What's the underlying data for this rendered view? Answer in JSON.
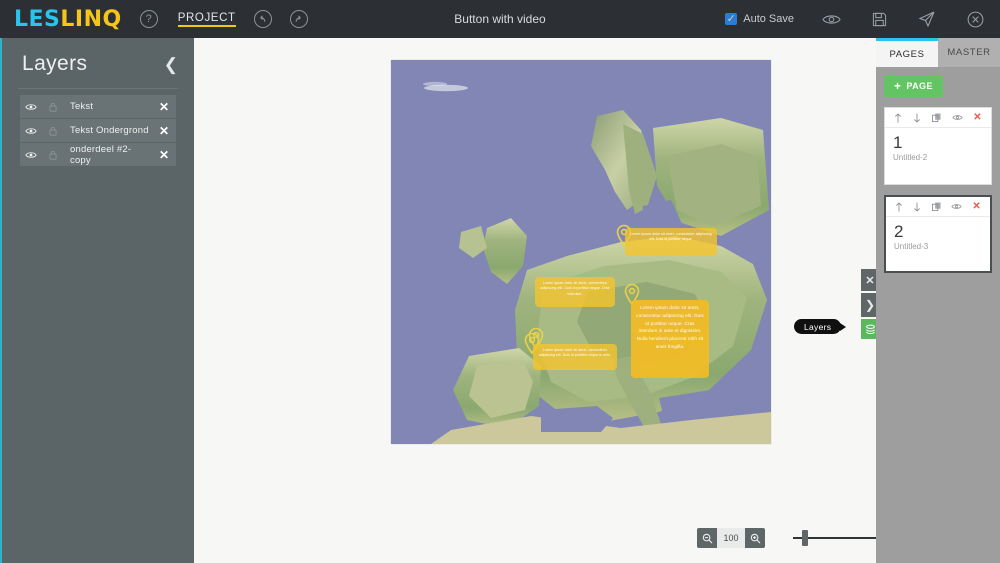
{
  "header": {
    "logo_les": "LES",
    "logo_linq": "LINQ",
    "help_icon": "question-circle-icon",
    "project_label": "PROJECT",
    "undo_icon": "undo-circle-icon",
    "redo_icon": "redo-circle-icon",
    "title": "Button with video",
    "autosave_label": "Auto Save",
    "autosave_checked": true,
    "preview_icon": "eye-icon",
    "save_icon": "floppy-disk-icon",
    "publish_icon": "paper-plane-icon",
    "close_icon": "close-circle-icon"
  },
  "layers": {
    "title": "Layers",
    "collapse_icon": "chevron-left-icon",
    "items": [
      {
        "name": "Tekst",
        "visible_icon": "eye-icon",
        "lock_icon": "lock-icon",
        "delete_icon": "close-icon"
      },
      {
        "name": "Tekst Ondergrond",
        "visible_icon": "eye-icon",
        "lock_icon": "lock-icon",
        "delete_icon": "close-icon"
      },
      {
        "name": "onderdeel #2-copy",
        "visible_icon": "eye-icon",
        "lock_icon": "lock-icon",
        "delete_icon": "close-icon"
      }
    ]
  },
  "canvas": {
    "markers": [
      {
        "id": "marker-north",
        "text": "Lorem ipsum dolor sit amet, consectetur adipiscing elit. Duis id porttitor neque."
      },
      {
        "id": "marker-west",
        "text": "Lorem ipsum dolor sit amet, consectetur adipiscing elit. Duis id porttitor neque. Cras interdum."
      },
      {
        "id": "marker-south",
        "text": "Lorem ipsum dolor sit amet, consectetur adipiscing elit. Duis id porttitor neque in ante."
      },
      {
        "id": "marker-central",
        "text": "Lorem ipsum dolor sit amet, consectetur adipiscing elit. Duis id porttitor neque. Cras interdum in ante et dignissim. Nulla hendrerit placerat nibh sit amet fringilla."
      }
    ],
    "float_close_icon": "close-icon",
    "float_expand_icon": "chevron-right-icon",
    "float_layers_icon": "layers-stack-icon",
    "layers_tooltip": "Layers"
  },
  "zoom": {
    "zoom_out_icon": "magnifier-minus-icon",
    "value": "100",
    "zoom_in_icon": "magnifier-plus-icon",
    "slider_position_percent": 11
  },
  "right_panel": {
    "tabs": [
      {
        "label": "PAGES",
        "active": true
      },
      {
        "label": "MASTER",
        "active": false
      }
    ],
    "add_page_label": "PAGE",
    "add_page_icon": "plus-icon",
    "pages": [
      {
        "number": "1",
        "label": "Untitled-2",
        "selected": false,
        "tools": [
          "arrow-up-icon",
          "arrow-down-icon",
          "duplicate-icon",
          "eye-icon",
          "close-icon"
        ]
      },
      {
        "number": "2",
        "label": "Untitled-3",
        "selected": true,
        "tools": [
          "arrow-up-icon",
          "arrow-down-icon",
          "duplicate-icon",
          "eye-icon",
          "close-icon"
        ]
      }
    ]
  },
  "colors": {
    "header_bg": "#2c3034",
    "accent_cyan": "#29c3ec",
    "accent_yellow": "#f5c518",
    "panel_gray": "#5b6466",
    "green": "#62c462",
    "map_ocean": "#8186b4"
  }
}
